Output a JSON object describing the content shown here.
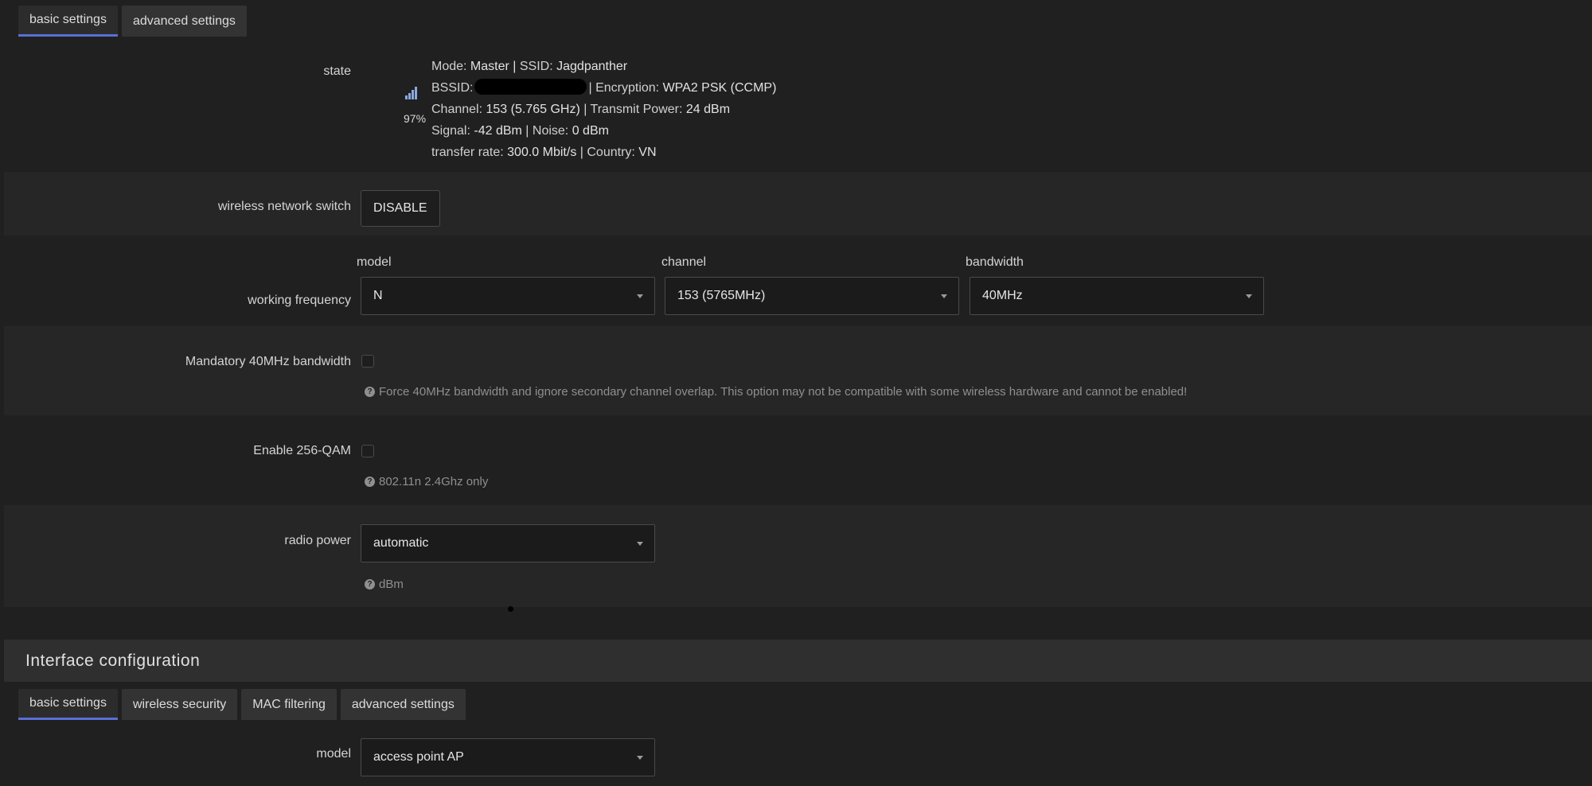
{
  "top_tabs": [
    "basic settings",
    "advanced settings"
  ],
  "state": {
    "label": "state",
    "signal_percent": "97%",
    "signal_value": 0.97,
    "mode_label": "Mode:",
    "mode": "Master",
    "ssid_label": "SSID:",
    "ssid": "Jagdpanther",
    "bssid_label": "BSSID:",
    "encryption_label": "| Encryption:",
    "encryption": "WPA2 PSK (CCMP)",
    "channel_label": "Channel:",
    "channel": "153 (5.765 GHz)",
    "txpower_label": "| Transmit Power:",
    "txpower": "24 dBm",
    "signal_label": "Signal:",
    "signal": "-42 dBm",
    "noise_label": "| Noise:",
    "noise": "0 dBm",
    "rate_label": "transfer rate:",
    "rate": "300.0 Mbit/s",
    "country_label": "| Country:",
    "country": "VN"
  },
  "wireless_switch": {
    "label": "wireless network switch",
    "button": "DISABLE"
  },
  "working_frequency": {
    "label": "working frequency",
    "model_header": "model",
    "model": "N",
    "channel_header": "channel",
    "channel": "153 (5765MHz)",
    "bandwidth_header": "bandwidth",
    "bandwidth": "40MHz"
  },
  "mandatory40": {
    "label": "Mandatory 40MHz bandwidth",
    "help": "Force 40MHz bandwidth and ignore secondary channel overlap. This option may not be compatible with some wireless hardware and cannot be enabled!"
  },
  "qam256": {
    "label": "Enable 256-QAM",
    "help": "802.11n 2.4Ghz only"
  },
  "radio_power": {
    "label": "radio power",
    "value": "automatic",
    "help": "dBm"
  },
  "interface": {
    "title": "Interface configuration",
    "tabs": [
      "basic settings",
      "wireless security",
      "MAC filtering",
      "advanced settings"
    ],
    "model_label": "model",
    "model_value": "access point AP"
  },
  "icons": {
    "help": "question-circle-icon",
    "signal": "signal-bars-icon",
    "caret": "caret-down-icon"
  }
}
